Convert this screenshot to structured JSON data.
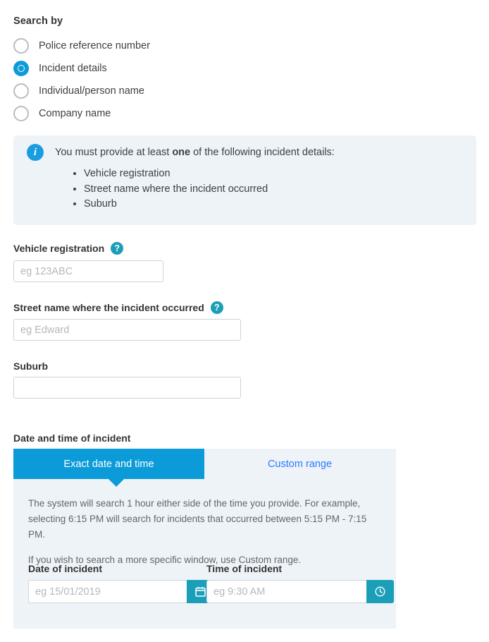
{
  "search_by": {
    "heading": "Search by",
    "options": [
      {
        "label": "Police reference number",
        "selected": false
      },
      {
        "label": "Incident details",
        "selected": true
      },
      {
        "label": "Individual/person name",
        "selected": false
      },
      {
        "label": "Company name",
        "selected": false
      }
    ]
  },
  "info_box": {
    "icon": "info-icon",
    "lead_prefix": "You must provide at least ",
    "lead_bold": "one",
    "lead_suffix": " of the following incident details:",
    "items": [
      "Vehicle registration",
      "Street name where the incident occurred",
      "Suburb"
    ]
  },
  "fields": {
    "vehicle_registration": {
      "label": "Vehicle registration",
      "help_icon": "question-mark-icon",
      "value": "",
      "placeholder": "eg 123ABC"
    },
    "street_name": {
      "label": "Street name where the incident occurred",
      "help_icon": "question-mark-icon",
      "value": "",
      "placeholder": "eg Edward"
    },
    "suburb": {
      "label": "Suburb",
      "value": "",
      "placeholder": ""
    }
  },
  "date_time_section": {
    "heading": "Date and time of incident",
    "tabs": [
      {
        "label": "Exact date and time",
        "active": true
      },
      {
        "label": "Custom range",
        "active": false
      }
    ],
    "description_paragraph_1": "The system will search 1 hour either side of the time you provide. For example, selecting 6:15 PM will search for incidents that occurred between 5:15 PM - 7:15 PM.",
    "description_paragraph_2": "If you wish to search a more specific window, use Custom range.",
    "date_of_incident": {
      "label": "Date of incident",
      "value": "",
      "placeholder": "eg 15/01/2019",
      "button_icon": "calendar-icon"
    },
    "time_of_incident": {
      "label": "Time of incident",
      "value": "",
      "placeholder": "eg 9:30 AM",
      "button_icon": "clock-icon"
    }
  },
  "colors": {
    "primary_blue": "#0c9bd9",
    "teal": "#1b9fb8",
    "info_blue": "#1a9de0",
    "panel_bg": "#eef3f8",
    "link_blue": "#2979ff"
  }
}
